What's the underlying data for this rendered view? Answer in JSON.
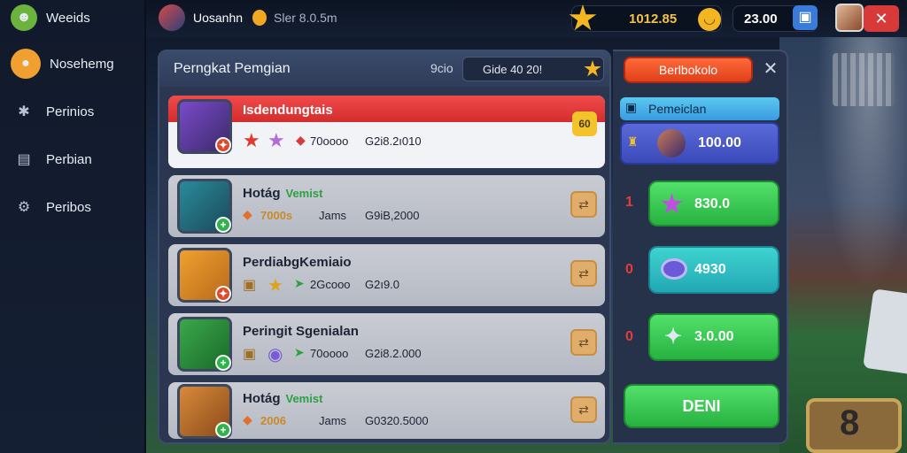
{
  "sidebar": {
    "items": [
      {
        "label": "Weeids",
        "icon": "smiley-icon"
      },
      {
        "label": "Nosehemg",
        "icon": "face-icon"
      },
      {
        "label": "Perinios",
        "icon": "puzzle-icon"
      },
      {
        "label": "Perbian",
        "icon": "book-icon"
      },
      {
        "label": "Peribos",
        "icon": "gear-icon"
      }
    ]
  },
  "topbar": {
    "username": "Uosanhn",
    "subtitle": "Sler 8.0.5m",
    "currency_value": "1012.85",
    "gems_value": "23.00"
  },
  "panel": {
    "title": "Perngkat Pemgian",
    "search_label": "9cio",
    "search_value": "Gide 40 20!",
    "rows": [
      {
        "name": "Isdendungtais",
        "tag": "",
        "stat1": "70oooo",
        "stat2": "G2i8.2ı010",
        "level": "60"
      },
      {
        "name": "Hotág",
        "tag": "Vemist",
        "stat1": "7000s",
        "stat2": "Jams",
        "stat3": "G9iB,2000"
      },
      {
        "name": "PerdiabgKemiaio",
        "tag": "",
        "stat1": "2Gcooo",
        "stat2": "G2ı9.0"
      },
      {
        "name": "Peringit Sgenialan",
        "tag": "",
        "stat1": "70oooo",
        "stat2": "G2i8.2.000"
      },
      {
        "name": "Hotág",
        "tag": "Vemist",
        "stat1": "2006",
        "stat2": "Jams",
        "stat3": "G0320.5000"
      }
    ]
  },
  "right": {
    "close_label": "Berlbokolo",
    "section_label": "Pemeiclan",
    "featured_value": "100.00",
    "offers": [
      {
        "rank": "1",
        "value": "830.0",
        "icon": "star-icon"
      },
      {
        "rank": "0",
        "value": "4930",
        "icon": "eye-icon"
      },
      {
        "rank": "0",
        "value": "3.0.00",
        "icon": "sparkle-icon"
      }
    ],
    "confirm_label": "DENI"
  }
}
